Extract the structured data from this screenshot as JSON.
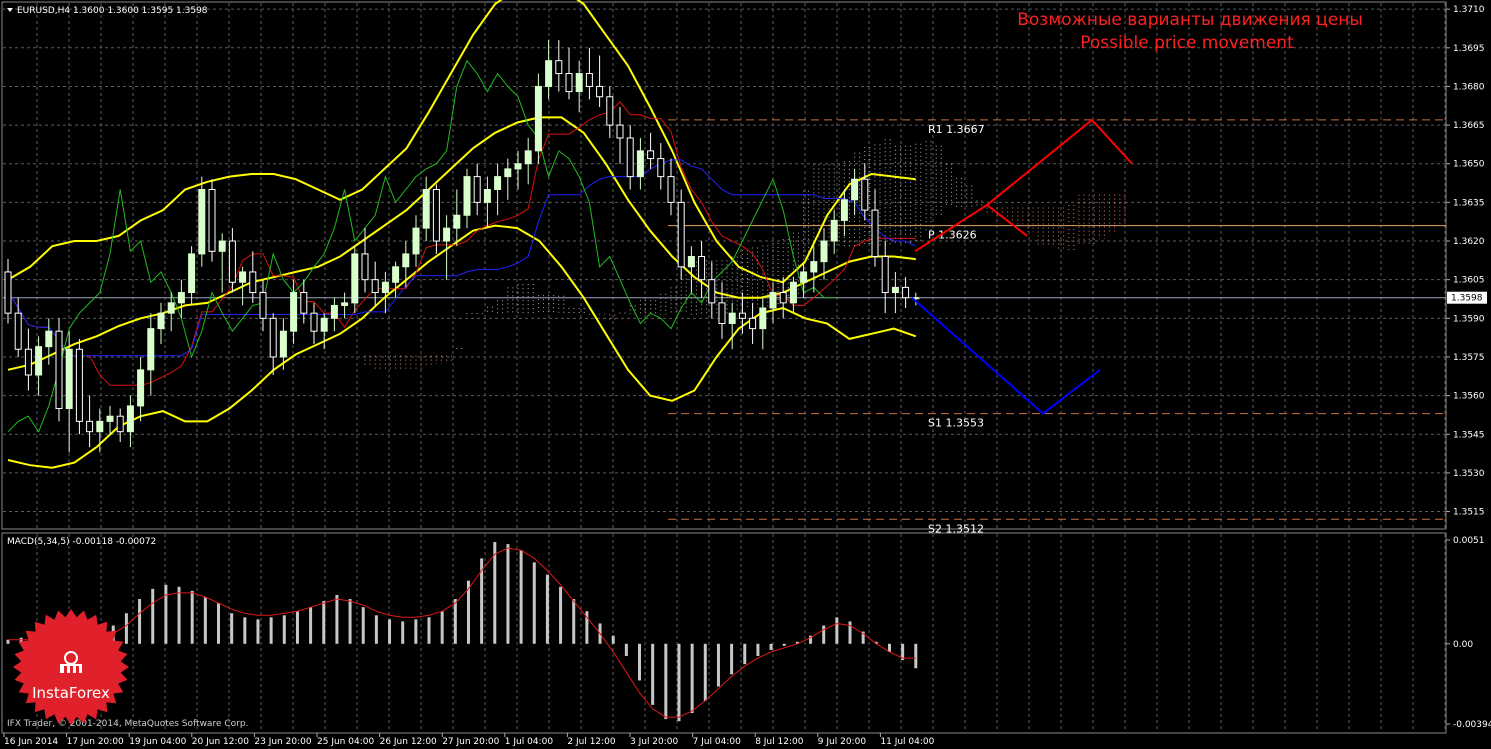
{
  "header": {
    "symbol_line": "EURUSD,H4  1.3600 1.3600 1.3595 1.3598",
    "title_ru": "Возможные варианты движения цены",
    "title_en": "Possible price movement"
  },
  "macd": {
    "label": "MACD(5,34,5) -0.00118 -0.00072",
    "tick_labels": [
      "0.0051",
      "0.00",
      "-0.00394"
    ]
  },
  "footer": {
    "copyright": "IFX Trader, © 2001-2014, MetaQuotes Software Corp.",
    "logo_text": "InstaForex"
  },
  "colors": {
    "background": "#000000",
    "grid": "#5a5a5a",
    "candle_bull": "#d8ffcc",
    "candle_bear": "#ffffff",
    "bollinger": "#ffff00",
    "tenkan": "#dd1111",
    "kijun": "#2222ff",
    "chikou": "#22bb22",
    "cloud_a": "#b0b0b0",
    "cloud_b": "#d08060",
    "forecast_up": "#ff0000",
    "forecast_down": "#0000ff",
    "level_line": "#c87040",
    "macd_bar": "#c8c8c8",
    "macd_signal": "#e01818",
    "price_label_bg": "#ffffff",
    "logo": "#e0202a"
  },
  "chart_data": [
    {
      "type": "candlestick",
      "symbol": "EURUSD",
      "timeframe": "H4",
      "ohlc_header": {
        "open": 1.36,
        "high": 1.36,
        "low": 1.3595,
        "close": 1.3598
      },
      "x_tick_labels": [
        "16 Jun 2014",
        "17 Jun 20:00",
        "19 Jun 04:00",
        "20 Jun 12:00",
        "23 Jun 20:00",
        "25 Jun 04:00",
        "26 Jun 12:00",
        "27 Jun 20:00",
        "1 Jul 04:00",
        "2 Jul 12:00",
        "3 Jul 20:00",
        "7 Jul 04:00",
        "8 Jul 12:00",
        "9 Jul 20:00",
        "11 Jul 04:00"
      ],
      "y_tick_labels": [
        "1.3710",
        "1.3695",
        "1.3680",
        "1.3665",
        "1.3650",
        "1.3635",
        "1.3620",
        "1.3605",
        "1.3590",
        "1.3575",
        "1.3560",
        "1.3545",
        "1.3530",
        "1.3515"
      ],
      "ylim": [
        1.3509,
        1.3712
      ],
      "current_price": 1.3598,
      "current_price_label": "1.3598",
      "candles": [
        [
          1.3608,
          1.3613,
          1.3588,
          1.3592
        ],
        [
          1.3592,
          1.3598,
          1.3575,
          1.3578
        ],
        [
          1.3578,
          1.3586,
          1.3562,
          1.3568
        ],
        [
          1.3568,
          1.3583,
          1.356,
          1.3579
        ],
        [
          1.3579,
          1.359,
          1.3572,
          1.3585
        ],
        [
          1.3585,
          1.359,
          1.355,
          1.3555
        ],
        [
          1.3555,
          1.3585,
          1.3538,
          1.3578
        ],
        [
          1.3578,
          1.3582,
          1.3545,
          1.355
        ],
        [
          1.355,
          1.356,
          1.354,
          1.3546
        ],
        [
          1.3546,
          1.3555,
          1.3538,
          1.355
        ],
        [
          1.355,
          1.3556,
          1.3545,
          1.3552
        ],
        [
          1.3552,
          1.3555,
          1.3542,
          1.3546
        ],
        [
          1.3546,
          1.356,
          1.354,
          1.3556
        ],
        [
          1.3556,
          1.3575,
          1.355,
          1.357
        ],
        [
          1.357,
          1.3592,
          1.356,
          1.3586
        ],
        [
          1.3586,
          1.3596,
          1.358,
          1.3592
        ],
        [
          1.3592,
          1.36,
          1.3585,
          1.3596
        ],
        [
          1.3596,
          1.3605,
          1.359,
          1.36
        ],
        [
          1.36,
          1.3618,
          1.3595,
          1.3615
        ],
        [
          1.3615,
          1.3645,
          1.361,
          1.364
        ],
        [
          1.364,
          1.3644,
          1.3612,
          1.3616
        ],
        [
          1.3616,
          1.3623,
          1.36,
          1.362
        ],
        [
          1.362,
          1.3625,
          1.36,
          1.3604
        ],
        [
          1.3604,
          1.361,
          1.3595,
          1.3608
        ],
        [
          1.3608,
          1.3616,
          1.3596,
          1.36
        ],
        [
          1.36,
          1.3605,
          1.3585,
          1.359
        ],
        [
          1.359,
          1.3592,
          1.3568,
          1.3575
        ],
        [
          1.3575,
          1.359,
          1.357,
          1.3585
        ],
        [
          1.3585,
          1.3605,
          1.358,
          1.36
        ],
        [
          1.36,
          1.3605,
          1.3588,
          1.3592
        ],
        [
          1.3592,
          1.3596,
          1.358,
          1.3585
        ],
        [
          1.3585,
          1.3592,
          1.3578,
          1.359
        ],
        [
          1.359,
          1.3598,
          1.3585,
          1.3595
        ],
        [
          1.3595,
          1.36,
          1.359,
          1.3596
        ],
        [
          1.3596,
          1.3618,
          1.3592,
          1.3615
        ],
        [
          1.3615,
          1.3625,
          1.36,
          1.3605
        ],
        [
          1.3605,
          1.3612,
          1.3595,
          1.36
        ],
        [
          1.36,
          1.3608,
          1.3592,
          1.3604
        ],
        [
          1.3604,
          1.3612,
          1.3598,
          1.361
        ],
        [
          1.361,
          1.362,
          1.3602,
          1.3615
        ],
        [
          1.3615,
          1.363,
          1.361,
          1.3625
        ],
        [
          1.3625,
          1.3645,
          1.362,
          1.364
        ],
        [
          1.364,
          1.3642,
          1.3615,
          1.362
        ],
        [
          1.362,
          1.363,
          1.3605,
          1.3625
        ],
        [
          1.3625,
          1.364,
          1.3618,
          1.363
        ],
        [
          1.363,
          1.3648,
          1.3625,
          1.3645
        ],
        [
          1.3645,
          1.365,
          1.363,
          1.3635
        ],
        [
          1.3635,
          1.3645,
          1.3625,
          1.364
        ],
        [
          1.364,
          1.365,
          1.363,
          1.3645
        ],
        [
          1.3645,
          1.3652,
          1.3636,
          1.3648
        ],
        [
          1.3648,
          1.3655,
          1.364,
          1.365
        ],
        [
          1.365,
          1.366,
          1.3642,
          1.3655
        ],
        [
          1.3655,
          1.3685,
          1.365,
          1.368
        ],
        [
          1.368,
          1.3698,
          1.3675,
          1.369
        ],
        [
          1.369,
          1.3698,
          1.3678,
          1.3685
        ],
        [
          1.3685,
          1.3695,
          1.3675,
          1.3678
        ],
        [
          1.3678,
          1.369,
          1.367,
          1.3685
        ],
        [
          1.3685,
          1.3695,
          1.3675,
          1.368
        ],
        [
          1.368,
          1.3692,
          1.3672,
          1.3676
        ],
        [
          1.3676,
          1.368,
          1.366,
          1.3665
        ],
        [
          1.3665,
          1.3672,
          1.365,
          1.366
        ],
        [
          1.366,
          1.3665,
          1.364,
          1.3645
        ],
        [
          1.3645,
          1.366,
          1.364,
          1.3655
        ],
        [
          1.3655,
          1.3662,
          1.3648,
          1.3652
        ],
        [
          1.3652,
          1.3658,
          1.364,
          1.3645
        ],
        [
          1.3645,
          1.3652,
          1.363,
          1.3635
        ],
        [
          1.3635,
          1.364,
          1.3605,
          1.361
        ],
        [
          1.361,
          1.3618,
          1.36,
          1.3614
        ],
        [
          1.3614,
          1.362,
          1.3598,
          1.3605
        ],
        [
          1.3605,
          1.3612,
          1.359,
          1.3596
        ],
        [
          1.3596,
          1.3604,
          1.3582,
          1.3588
        ],
        [
          1.3588,
          1.3596,
          1.3578,
          1.3592
        ],
        [
          1.3592,
          1.36,
          1.3584,
          1.359
        ],
        [
          1.359,
          1.3596,
          1.358,
          1.3586
        ],
        [
          1.3586,
          1.3598,
          1.3578,
          1.3594
        ],
        [
          1.3594,
          1.3604,
          1.3588,
          1.36
        ],
        [
          1.36,
          1.3606,
          1.359,
          1.3596
        ],
        [
          1.3596,
          1.3606,
          1.3592,
          1.3604
        ],
        [
          1.3604,
          1.3612,
          1.3598,
          1.3608
        ],
        [
          1.3608,
          1.3618,
          1.36,
          1.3612
        ],
        [
          1.3612,
          1.3625,
          1.3605,
          1.362
        ],
        [
          1.362,
          1.3632,
          1.3615,
          1.3628
        ],
        [
          1.3628,
          1.364,
          1.3622,
          1.3636
        ],
        [
          1.3636,
          1.3648,
          1.363,
          1.3644
        ],
        [
          1.3644,
          1.365,
          1.3628,
          1.3632
        ],
        [
          1.3632,
          1.364,
          1.361,
          1.3614
        ],
        [
          1.3614,
          1.362,
          1.3592,
          1.36
        ],
        [
          1.36,
          1.3608,
          1.3592,
          1.3602
        ],
        [
          1.3602,
          1.3606,
          1.3594,
          1.3598
        ],
        [
          1.3598,
          1.36,
          1.3595,
          1.3598
        ]
      ],
      "bollinger_upper": [
        1.3605,
        1.361,
        1.3618,
        1.362,
        1.362,
        1.3622,
        1.3628,
        1.3632,
        1.364,
        1.3643,
        1.3645,
        1.3646,
        1.3646,
        1.3644,
        1.364,
        1.3636,
        1.364,
        1.3648,
        1.3656,
        1.367,
        1.3685,
        1.37,
        1.3712,
        1.3718,
        1.372,
        1.3718,
        1.3712,
        1.37,
        1.3688,
        1.3672,
        1.3655,
        1.3635,
        1.362,
        1.361,
        1.3606,
        1.3604,
        1.3612,
        1.363,
        1.3642,
        1.3646,
        1.3645,
        1.3644
      ],
      "bollinger_middle": [
        1.357,
        1.3572,
        1.3576,
        1.358,
        1.3583,
        1.3587,
        1.359,
        1.3592,
        1.3595,
        1.3596,
        1.36,
        1.3604,
        1.3606,
        1.3608,
        1.361,
        1.3614,
        1.362,
        1.3626,
        1.3632,
        1.364,
        1.3648,
        1.3656,
        1.3662,
        1.3666,
        1.3668,
        1.3668,
        1.3662,
        1.365,
        1.3636,
        1.3624,
        1.3614,
        1.3606,
        1.36,
        1.3598,
        1.3598,
        1.36,
        1.3604,
        1.3608,
        1.3612,
        1.3614,
        1.3614,
        1.3613
      ],
      "bollinger_lower": [
        1.3535,
        1.3533,
        1.3532,
        1.3534,
        1.354,
        1.3548,
        1.3552,
        1.3554,
        1.355,
        1.355,
        1.3555,
        1.3562,
        1.357,
        1.3576,
        1.358,
        1.3584,
        1.359,
        1.3598,
        1.3605,
        1.3612,
        1.3618,
        1.3624,
        1.3626,
        1.3625,
        1.362,
        1.361,
        1.3598,
        1.3584,
        1.357,
        1.356,
        1.3558,
        1.3562,
        1.3575,
        1.3586,
        1.3592,
        1.3594,
        1.359,
        1.3588,
        1.3582,
        1.3584,
        1.3586,
        1.3583
      ],
      "levels": [
        {
          "label": "R1 1.3667",
          "value": 1.3667
        },
        {
          "label": "P  1.3626",
          "value": 1.3626
        },
        {
          "label": "S1 1.3553",
          "value": 1.3553
        },
        {
          "label": "S2 1.3512",
          "value": 1.3512
        }
      ],
      "forecast_up": [
        1.3616,
        1.3634,
        1.3667,
        1.365
      ],
      "forecast_up_branch": [
        1.3634,
        1.3622
      ],
      "forecast_down": [
        1.3598,
        1.3553,
        1.357
      ]
    },
    {
      "type": "bar",
      "name": "MACD(5,34,5)",
      "ylim": [
        -0.00394,
        0.0051
      ],
      "values": [
        0.0002,
        0.0003,
        0.0001,
        -0.0001,
        0.0,
        0.0002,
        0.0003,
        0.0005,
        0.0009,
        0.0015,
        0.0022,
        0.0027,
        0.0029,
        0.0028,
        0.0026,
        0.0023,
        0.002,
        0.0015,
        0.0013,
        0.0012,
        0.0013,
        0.0014,
        0.0016,
        0.0018,
        0.0021,
        0.0024,
        0.0022,
        0.0018,
        0.0014,
        0.0012,
        0.0011,
        0.0012,
        0.0013,
        0.0016,
        0.0022,
        0.0031,
        0.0042,
        0.005,
        0.0049,
        0.0046,
        0.004,
        0.0034,
        0.0028,
        0.0022,
        0.0016,
        0.001,
        0.0004,
        -0.0006,
        -0.0018,
        -0.003,
        -0.0037,
        -0.0038,
        -0.0034,
        -0.0028,
        -0.0021,
        -0.0015,
        -0.001,
        -0.0006,
        -0.0003,
        -0.0001,
        0.0001,
        0.0004,
        0.0009,
        0.0013,
        0.0011,
        0.0006,
        0.0001,
        -0.0004,
        -0.0008,
        -0.0012
      ],
      "signal": [
        0.0002,
        0.0002,
        0.0002,
        0.0001,
        0.0001,
        0.0001,
        0.0002,
        0.0003,
        0.0005,
        0.0009,
        0.0015,
        0.002,
        0.0024,
        0.0025,
        0.0025,
        0.0023,
        0.002,
        0.0017,
        0.0015,
        0.0014,
        0.0014,
        0.0015,
        0.0016,
        0.0018,
        0.002,
        0.0022,
        0.0021,
        0.0019,
        0.0016,
        0.0014,
        0.0013,
        0.0013,
        0.0014,
        0.0016,
        0.002,
        0.0027,
        0.0036,
        0.0044,
        0.0047,
        0.0046,
        0.0042,
        0.0036,
        0.0029,
        0.0021,
        0.0013,
        0.0005,
        -0.0004,
        -0.0014,
        -0.0024,
        -0.0032,
        -0.0036,
        -0.0036,
        -0.0033,
        -0.0028,
        -0.0022,
        -0.0016,
        -0.0011,
        -0.0007,
        -0.0004,
        -0.0002,
        0.0,
        0.0003,
        0.0007,
        0.001,
        0.0009,
        0.0005,
        0.0,
        -0.0004,
        -0.0007,
        -0.0007
      ]
    }
  ]
}
